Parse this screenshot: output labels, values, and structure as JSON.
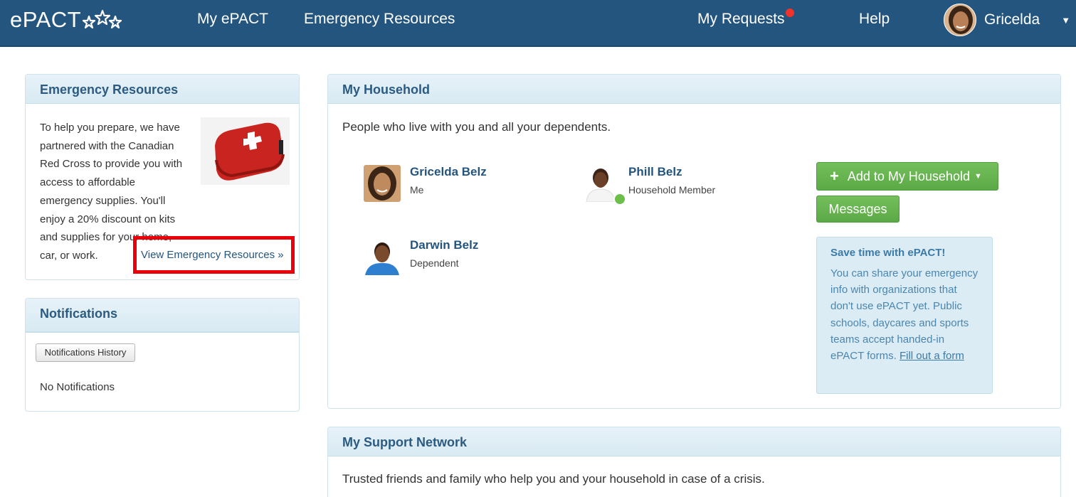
{
  "nav": {
    "logo": "ePACT",
    "my_epact": "My ePACT",
    "emergency_resources": "Emergency Resources",
    "my_requests": "My Requests",
    "help": "Help",
    "user_name": "Gricelda"
  },
  "emergency_panel": {
    "title": "Emergency Resources",
    "text": "To help you prepare, we have partnered with the Canadian Red Cross to provide you with access to affordable emergency supplies. You'll enjoy a 20% discount on kits and supplies for your home, car, or work.",
    "link": "View Emergency Resources »"
  },
  "notifications_panel": {
    "title": "Notifications",
    "history_button": "Notifications History",
    "empty_text": "No Notifications"
  },
  "household_panel": {
    "title": "My Household",
    "description": "People who live with you and all your dependents.",
    "members": [
      {
        "name": "Gricelda Belz",
        "role": "Me"
      },
      {
        "name": "Phill Belz",
        "role": "Household Member"
      },
      {
        "name": "Darwin Belz",
        "role": "Dependent"
      }
    ],
    "add_button": "Add to My Household",
    "messages_button": "Messages",
    "tip": {
      "title": "Save time with ePACT!",
      "body": "You can share your emergency info with organizations that don't use ePACT yet. Public schools, daycares and sports teams accept handed-in ePACT forms.",
      "link": "Fill out a form"
    }
  },
  "support_panel": {
    "title": "My Support Network",
    "description": "Trusted friends and family who help you and your household in case of a crisis."
  }
}
